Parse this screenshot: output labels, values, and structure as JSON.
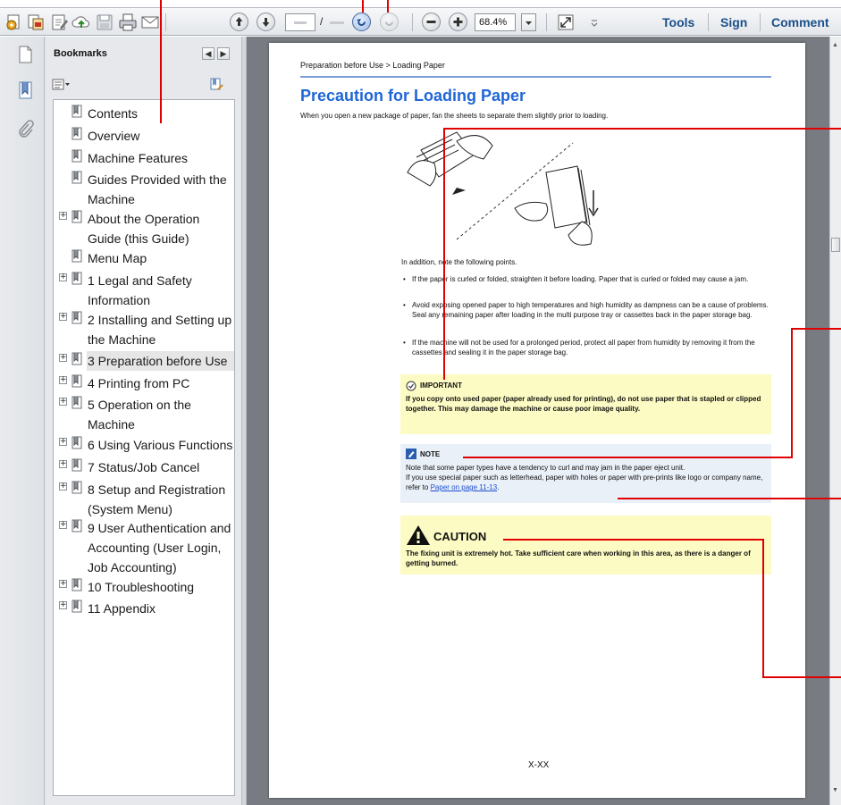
{
  "toolbar": {
    "page_current": "",
    "page_separator": "/",
    "page_total": "",
    "zoom_value": "68.4%",
    "tools_label": "Tools",
    "sign_label": "Sign",
    "comment_label": "Comment"
  },
  "bookmarks": {
    "title": "Bookmarks",
    "items": [
      {
        "label": "Contents",
        "expandable": false,
        "selected": false
      },
      {
        "label": "Overview",
        "expandable": false,
        "selected": false
      },
      {
        "label": "Machine Features",
        "expandable": false,
        "selected": false
      },
      {
        "label": "Guides Provided with the Machine",
        "expandable": false,
        "selected": false
      },
      {
        "label": "About the Operation Guide (this Guide)",
        "expandable": true,
        "selected": false
      },
      {
        "label": "Menu Map",
        "expandable": false,
        "selected": false
      },
      {
        "label": "1 Legal and Safety Information",
        "expandable": true,
        "selected": false
      },
      {
        "label": "2 Installing and Setting up the Machine",
        "expandable": true,
        "selected": false
      },
      {
        "label": "3 Preparation before Use",
        "expandable": true,
        "selected": true
      },
      {
        "label": "4 Printing from PC",
        "expandable": true,
        "selected": false
      },
      {
        "label": "5 Operation on the Machine",
        "expandable": true,
        "selected": false
      },
      {
        "label": "6 Using Various Functions",
        "expandable": true,
        "selected": false
      },
      {
        "label": "7 Status/Job Cancel",
        "expandable": true,
        "selected": false
      },
      {
        "label": "8 Setup and Registration (System Menu)",
        "expandable": true,
        "selected": false
      },
      {
        "label": "9 User Authentication and Accounting (User Login, Job Accounting)",
        "expandable": true,
        "selected": false
      },
      {
        "label": "10 Troubleshooting",
        "expandable": true,
        "selected": false
      },
      {
        "label": "11 Appendix",
        "expandable": true,
        "selected": false
      }
    ]
  },
  "page": {
    "breadcrumb": "Preparation before Use > Loading Paper",
    "title": "Precaution for Loading Paper",
    "intro": "When you open a new package of paper, fan the sheets to separate them slightly prior to loading.",
    "addition": "In addition, note the following points.",
    "bullets": [
      "If the paper is curled or folded, straighten it before loading. Paper that is curled or folded may cause a jam.",
      "Avoid exposing opened paper to high temperatures and high humidity as dampness can be a cause of problems. Seal any remaining paper after loading in the multi purpose tray or cassettes back in the paper storage bag.",
      "If the machine will not be used for a prolonged period, protect all paper from humidity by removing it from the cassettes and sealing it in the paper storage bag."
    ],
    "important_head": "IMPORTANT",
    "important_text": "If you copy onto used paper (paper already used for printing), do not use paper that is stapled or clipped together. This may damage the machine or cause poor image quality.",
    "note_head": "NOTE",
    "note_line1": "Note that some paper types have a tendency to curl and may jam in the paper eject unit.",
    "note_line2": "If you use special paper such as letterhead, paper with holes or paper with pre-prints like logo or company name, refer to",
    "note_link": "Paper on page 11-13",
    "note_end": ".",
    "caution_head": "CAUTION",
    "caution_text": "The fixing unit is extremely hot. Take sufficient care when working in this area, as there is a danger of getting burned.",
    "footer": "X-XX"
  },
  "colors": {
    "title_blue": "#1f66d6",
    "callout_red": "#e00000",
    "important_bg": "#fdfbc4",
    "note_bg": "#eaf0f8"
  }
}
